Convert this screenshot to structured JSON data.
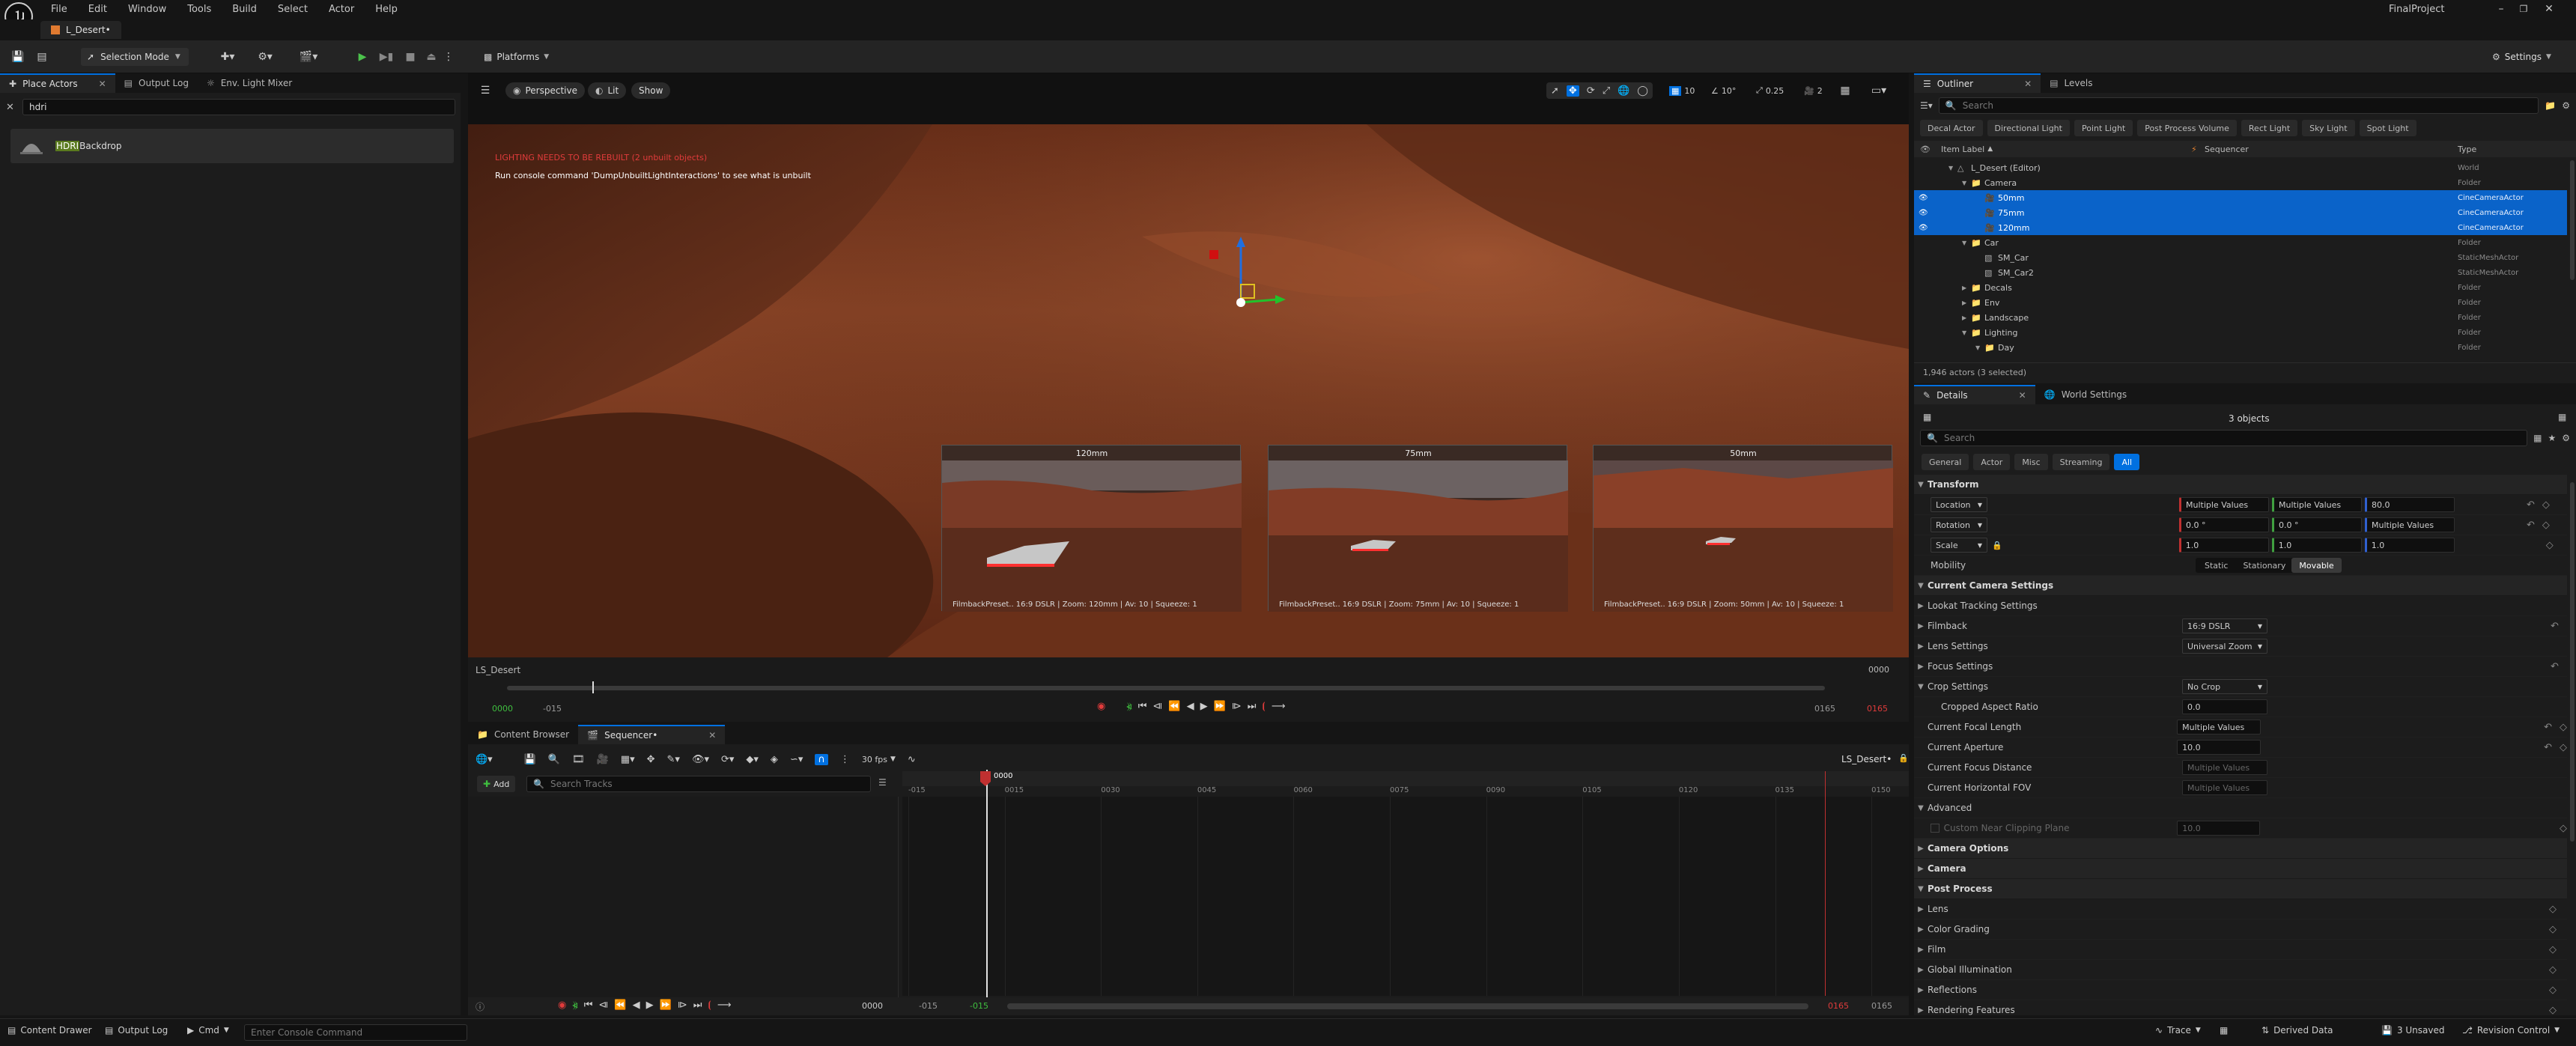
{
  "menubar": {
    "items": [
      "File",
      "Edit",
      "Window",
      "Tools",
      "Build",
      "Select",
      "Actor",
      "Help"
    ],
    "project": "FinalProject"
  },
  "titlebar": {
    "level_tab": "L_Desert•"
  },
  "toolbar": {
    "mode": "Selection Mode",
    "platforms": "Platforms",
    "settings": "Settings"
  },
  "left_panel": {
    "tabs": [
      "Place Actors",
      "Output Log",
      "Env. Light Mixer"
    ],
    "search_value": "hdri",
    "item_highlight": "HDRI",
    "item_rest": "Backdrop"
  },
  "viewport": {
    "perspective": "Perspective",
    "lit": "Lit",
    "show": "Show",
    "error_line1": "LIGHTING NEEDS TO BE REBUILT (2 unbuilt objects)",
    "error_line2": "Run console command 'DumpUnbuiltLightInteractions' to see what is unbuilt",
    "grid_value": "10",
    "angle_value": "10°",
    "scale_value": "0.25",
    "cam_speed": "2",
    "thumbnails": [
      {
        "title": "120mm",
        "caption": "FilmbackPreset.. 16:9 DSLR | Zoom: 120mm | Av: 10 | Squeeze: 1"
      },
      {
        "title": "75mm",
        "caption": "FilmbackPreset.. 16:9 DSLR | Zoom: 75mm | Av: 10 | Squeeze: 1"
      },
      {
        "title": "50mm",
        "caption": "FilmbackPreset.. 16:9 DSLR | Zoom: 50mm | Av: 10 | Squeeze: 1"
      }
    ]
  },
  "transport": {
    "sequence": "LS_Desert",
    "frame_right": "0000",
    "left_green": "0000",
    "left_gray": "-015",
    "right_gray": "0165",
    "right_red": "0165"
  },
  "bottom": {
    "tabs": [
      "Content Browser",
      "Sequencer•"
    ],
    "fps": "30 fps",
    "sequence_name": "LS_Desert•",
    "add": "Add",
    "search_tracks": "Search Tracks",
    "playhead": "0000",
    "ticks": [
      "-015",
      "0015",
      "0030",
      "0045",
      "0060",
      "0075",
      "0090",
      "0105",
      "0120",
      "0135",
      "0150"
    ],
    "bottom_frame": "0000",
    "bl1": "-015",
    "bl2": "-015",
    "br1": "0165",
    "br2": "0165"
  },
  "outliner": {
    "tabs": [
      "Outliner",
      "Levels"
    ],
    "search_placeholder": "Search",
    "filters": [
      "Decal Actor",
      "Directional Light",
      "Point Light",
      "Post Process Volume",
      "Rect Light",
      "Sky Light",
      "Spot Light"
    ],
    "col_label": "Item Label",
    "col_seq": "Sequencer",
    "col_type": "Type",
    "rows": [
      {
        "label": "L_Desert (Editor)",
        "type": "World",
        "indent": 1,
        "kind": "world",
        "selected": false
      },
      {
        "label": "Camera",
        "type": "Folder",
        "indent": 2,
        "kind": "folder",
        "selected": false
      },
      {
        "label": "50mm",
        "type": "CineCameraActor",
        "indent": 3,
        "kind": "actor",
        "selected": true
      },
      {
        "label": "75mm",
        "type": "CineCameraActor",
        "indent": 3,
        "kind": "actor",
        "selected": true
      },
      {
        "label": "120mm",
        "type": "CineCameraActor",
        "indent": 3,
        "kind": "actor",
        "selected": true
      },
      {
        "label": "Car",
        "type": "Folder",
        "indent": 2,
        "kind": "folder",
        "selected": false
      },
      {
        "label": "SM_Car",
        "type": "StaticMeshActor",
        "indent": 3,
        "kind": "actor",
        "selected": false
      },
      {
        "label": "SM_Car2",
        "type": "StaticMeshActor",
        "indent": 3,
        "kind": "actor",
        "selected": false
      },
      {
        "label": "Decals",
        "type": "Folder",
        "indent": 2,
        "kind": "folder",
        "selected": false
      },
      {
        "label": "Env",
        "type": "Folder",
        "indent": 2,
        "kind": "folder",
        "selected": false
      },
      {
        "label": "Landscape",
        "type": "Folder",
        "indent": 2,
        "kind": "folder",
        "selected": false
      },
      {
        "label": "Lighting",
        "type": "Folder",
        "indent": 2,
        "kind": "folder",
        "selected": false
      },
      {
        "label": "Day",
        "type": "Folder",
        "indent": 3,
        "kind": "folder",
        "selected": false
      }
    ],
    "status": "1,946 actors (3 selected)"
  },
  "details": {
    "tabs": [
      "Details",
      "World Settings"
    ],
    "objects": "3 objects",
    "search_placeholder": "Search",
    "filter_tabs": [
      "General",
      "Actor",
      "Misc",
      "Streaming",
      "All"
    ],
    "transform": "Transform",
    "location": "Location",
    "rotation": "Rotation",
    "scale": "Scale",
    "mobility": "Mobility",
    "loc_values": [
      "Multiple Values",
      "Multiple Values",
      "80.0"
    ],
    "rot_values": [
      "0.0 °",
      "0.0 °",
      "Multiple Values"
    ],
    "scale_values": [
      "1.0",
      "1.0",
      "1.0"
    ],
    "mobility_options": [
      "Static",
      "Stationary",
      "Movable"
    ],
    "current_camera_settings": "Current Camera Settings",
    "lookat": "Lookat Tracking Settings",
    "filmback": "Filmback",
    "filmback_value": "16:9 DSLR",
    "lens_settings": "Lens Settings",
    "lens_value": "Universal Zoom",
    "focus_settings": "Focus Settings",
    "crop_settings": "Crop Settings",
    "crop_value": "No Crop",
    "cropped_aspect": "Cropped Aspect Ratio",
    "cropped_aspect_value": "0.0",
    "focal_length": "Current Focal Length",
    "focal_value": "Multiple Values",
    "aperture": "Current Aperture",
    "aperture_value": "10.0",
    "focus_distance": "Current Focus Distance",
    "focus_distance_value": "Multiple Values",
    "hfov": "Current Horizontal FOV",
    "hfov_value": "Multiple Values",
    "advanced": "Advanced",
    "custom_near": "Custom Near Clipping Plane",
    "custom_near_value": "10.0",
    "camera_options": "Camera Options",
    "camera": "Camera",
    "post_process": "Post Process",
    "pp_items": [
      "Lens",
      "Color Grading",
      "Film",
      "Global Illumination",
      "Reflections",
      "Rendering Features"
    ]
  },
  "statusbar": {
    "content_drawer": "Content Drawer",
    "output_log": "Output Log",
    "cmd": "Cmd",
    "console_placeholder": "Enter Console Command",
    "trace": "Trace",
    "derived_data": "Derived Data",
    "unsaved": "3 Unsaved",
    "revision": "Revision Control"
  },
  "colors": {
    "accent": "#0070e0",
    "selected_row": "#0a63c9",
    "record_red": "#e03b3b",
    "green": "#3fbf3f",
    "desert": "#8a3f22"
  }
}
